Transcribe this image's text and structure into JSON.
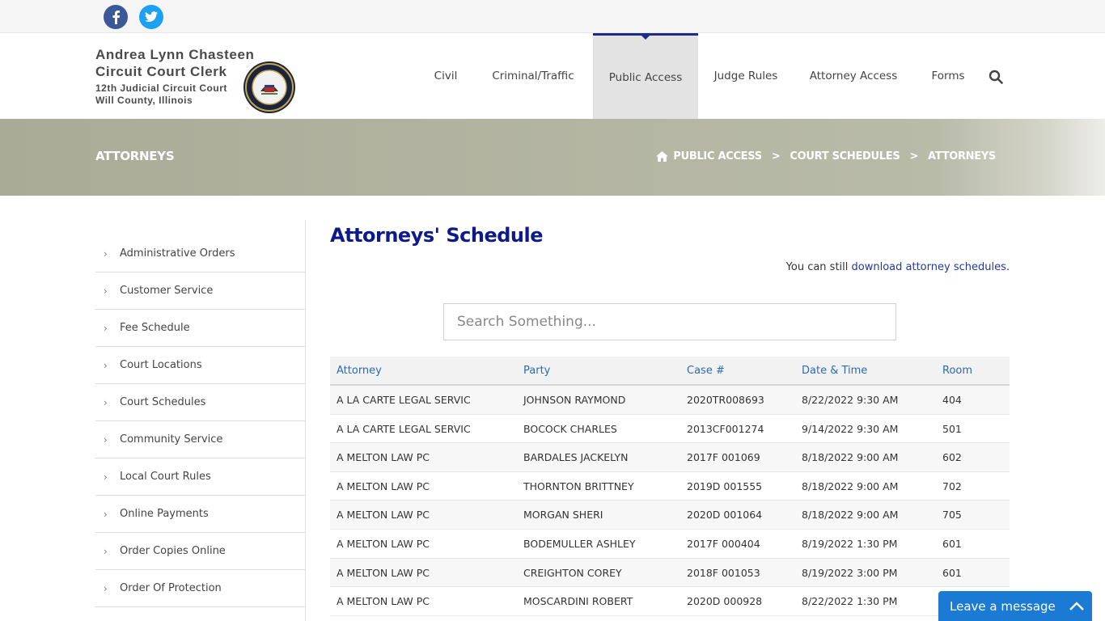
{
  "social": {
    "facebook_icon": "facebook-icon",
    "twitter_icon": "twitter-icon"
  },
  "logo": {
    "line1": "Andrea Lynn Chasteen",
    "line2": "Circuit Court Clerk",
    "line3": "12th Judicial Circuit Court",
    "line4": "Will County, Illinois"
  },
  "nav": {
    "items": [
      {
        "label": "Civil"
      },
      {
        "label": "Criminal/Traffic"
      },
      {
        "label": "Public Access"
      },
      {
        "label": "Judge Rules"
      },
      {
        "label": "Attorney Access"
      },
      {
        "label": "Forms"
      }
    ],
    "active": "Public Access"
  },
  "banner": {
    "title": "ATTORNEYS",
    "breadcrumbs": [
      "PUBLIC ACCESS",
      "COURT SCHEDULES",
      "ATTORNEYS"
    ],
    "separator": ">"
  },
  "sidebar": {
    "items": [
      {
        "label": "Administrative Orders"
      },
      {
        "label": "Customer Service"
      },
      {
        "label": "Fee Schedule"
      },
      {
        "label": "Court Locations"
      },
      {
        "label": "Court Schedules"
      },
      {
        "label": "Community Service"
      },
      {
        "label": "Local Court Rules"
      },
      {
        "label": "Online Payments"
      },
      {
        "label": "Order Copies Online"
      },
      {
        "label": "Order Of Protection"
      }
    ]
  },
  "main": {
    "title": "Attorneys' Schedule",
    "note_prefix": "You can still ",
    "note_link": "download attorney schedules",
    "note_suffix": ".",
    "search_placeholder": "Search Something..."
  },
  "table": {
    "headers": [
      "Attorney",
      "Party",
      "Case #",
      "Date & Time",
      "Room"
    ],
    "rows": [
      [
        "A LA CARTE LEGAL SERVIC",
        "JOHNSON RAYMOND",
        "2020TR008693",
        "8/22/2022 9:30 AM",
        "404"
      ],
      [
        "A LA CARTE LEGAL SERVIC",
        "BOCOCK CHARLES",
        "2013CF001274",
        "9/14/2022 9:30 AM",
        "501"
      ],
      [
        "A MELTON LAW PC",
        "BARDALES JACKELYN",
        "2017F 001069",
        "8/18/2022 9:00 AM",
        "602"
      ],
      [
        "A MELTON LAW PC",
        "THORNTON BRITTNEY",
        "2019D 001555",
        "8/18/2022 9:00 AM",
        "702"
      ],
      [
        "A MELTON LAW PC",
        "MORGAN SHERI",
        "2020D 001064",
        "8/18/2022 9:00 AM",
        "705"
      ],
      [
        "A MELTON LAW PC",
        "BODEMULLER ASHLEY",
        "2017F 000404",
        "8/19/2022 1:30 PM",
        "601"
      ],
      [
        "A MELTON LAW PC",
        "CREIGHTON COREY",
        "2018F 001053",
        "8/19/2022 3:00 PM",
        "601"
      ],
      [
        "A MELTON LAW PC",
        "MOSCARDINI ROBERT",
        "2020D 000928",
        "8/22/2022 1:30 PM",
        ""
      ]
    ]
  },
  "chat": {
    "label": "Leave a message"
  },
  "colors": {
    "nav_accent": "#1f2a8a",
    "title_blue": "#0c1a8a",
    "link_blue": "#2a6bb3",
    "chat_blue": "#1a7ad4"
  }
}
